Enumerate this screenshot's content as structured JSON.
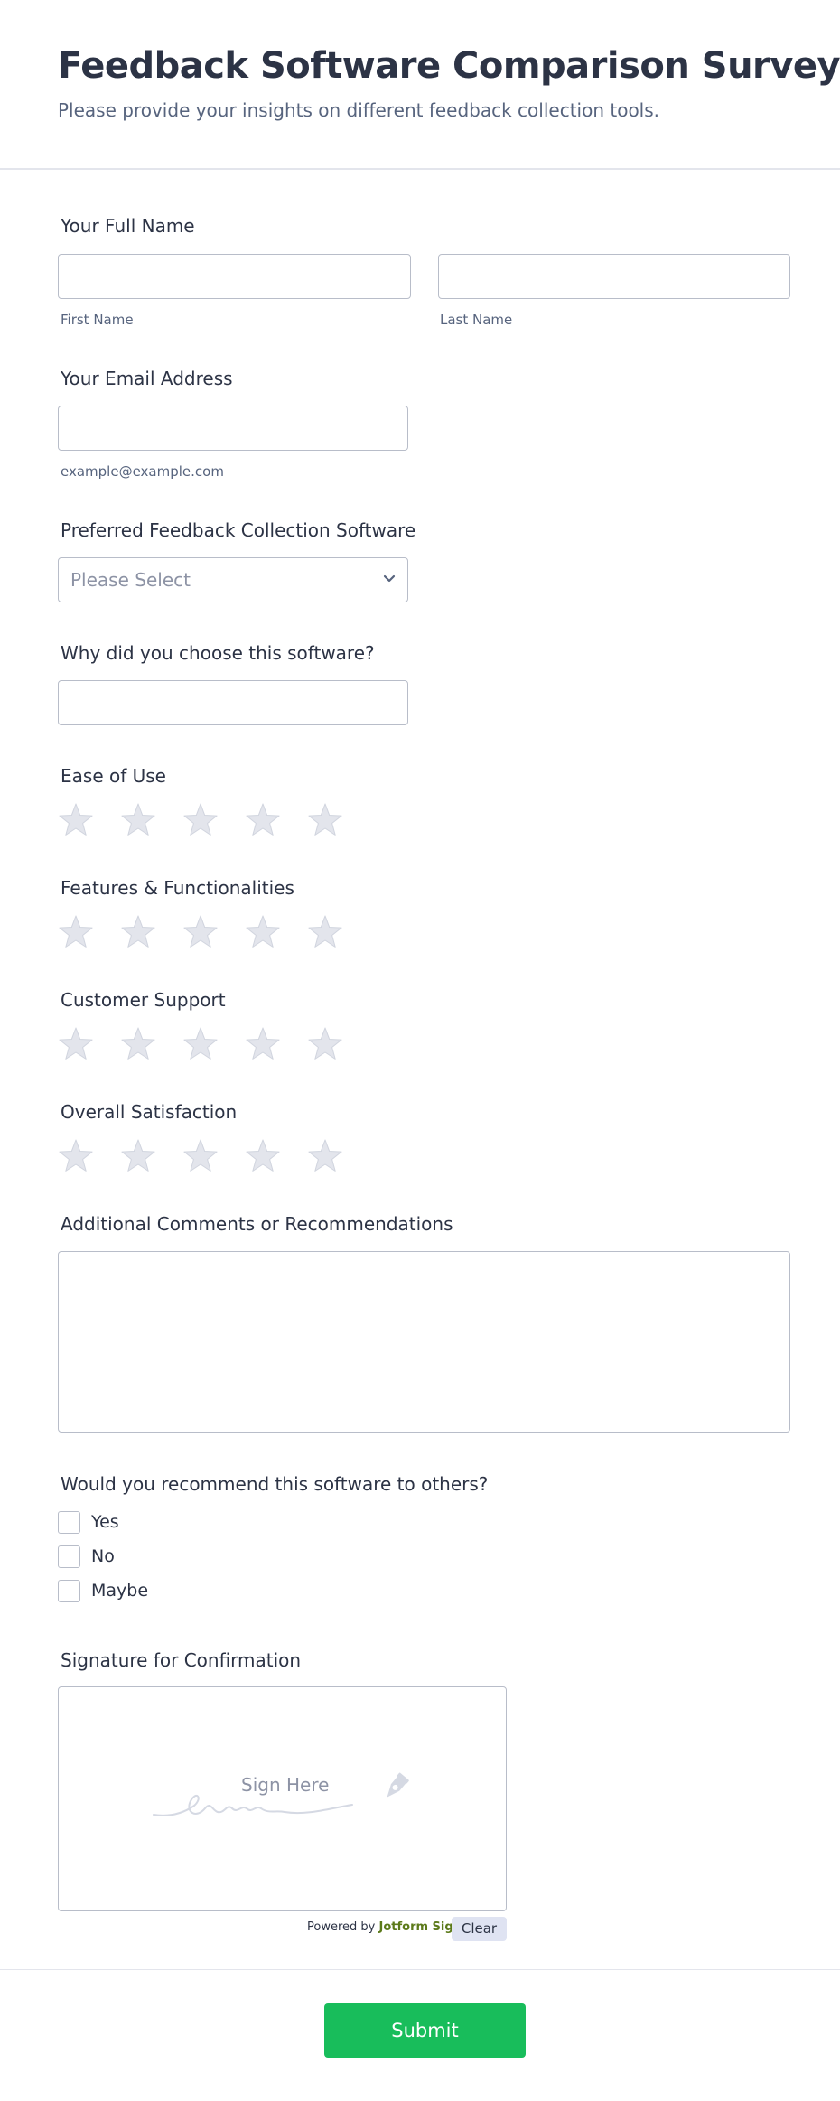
{
  "form": {
    "title": "Feedback Software Comparison Survey",
    "subtitle": "Please provide your insights on different feedback collection tools."
  },
  "full_name": {
    "label": "Your Full Name",
    "first_sublabel": "First Name",
    "last_sublabel": "Last Name",
    "first_value": "",
    "last_value": ""
  },
  "email": {
    "label": "Your Email Address",
    "sublabel": "example@example.com",
    "value": ""
  },
  "software": {
    "label": "Preferred Feedback Collection Software",
    "placeholder": "Please Select"
  },
  "reason": {
    "label": "Why did you choose this software?",
    "value": ""
  },
  "ratings": [
    {
      "label": "Ease of Use",
      "max": 5,
      "value": 0
    },
    {
      "label": "Features & Functionalities",
      "max": 5,
      "value": 0
    },
    {
      "label": "Customer Support",
      "max": 5,
      "value": 0
    },
    {
      "label": "Overall Satisfaction",
      "max": 5,
      "value": 0
    }
  ],
  "comments": {
    "label": "Additional Comments or Recommendations",
    "value": ""
  },
  "recommend": {
    "label": "Would you recommend this software to others?",
    "options": [
      "Yes",
      "No",
      "Maybe"
    ]
  },
  "signature": {
    "label": "Signature for Confirmation",
    "placeholder": "Sign Here",
    "powered_prefix": "Powered by",
    "powered_brand": "Jotform Sign",
    "clear_label": "Clear"
  },
  "submit_label": "Submit",
  "colors": {
    "primary_text": "#2c3345",
    "secondary_text": "#57647e",
    "border": "#b8bdc9",
    "star_empty": "#e3e5ec",
    "submit": "#18bd5b",
    "clear_bg": "#dfe3f2"
  },
  "icons": {
    "rating": "star-icon",
    "select": "chevron-down-icon",
    "signature": "pen-nib-icon"
  }
}
